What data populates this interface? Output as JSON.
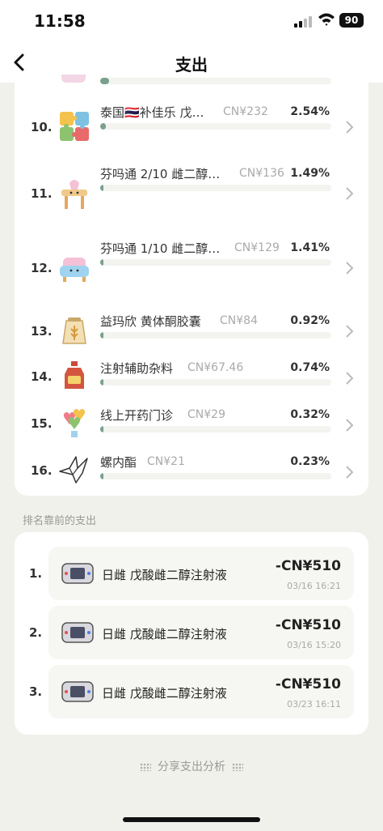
{
  "status": {
    "time": "11:58",
    "battery": "90"
  },
  "nav": {
    "title": "支出"
  },
  "categories": [
    {
      "rank": "10.",
      "name": "泰国🇹🇭补佳乐 戊…",
      "amount": "CN¥232",
      "pct": "2.54%",
      "fill": 0.024,
      "icon": "puzzle-icon"
    },
    {
      "rank": "11.",
      "name": "芬吗通 2/10 雌二醇…",
      "amount": "CN¥136",
      "pct": "1.49%",
      "fill": 0.014,
      "icon": "cute-table-icon"
    },
    {
      "rank": "12.",
      "name": "芬吗通 1/10 雌二醇…",
      "amount": "CN¥129",
      "pct": "1.41%",
      "fill": 0.013,
      "icon": "cute-sofa-icon"
    },
    {
      "rank": "13.",
      "name": "益玛欣 黄体酮胶囊",
      "amount": "CN¥84",
      "pct": "0.92%",
      "fill": 0.009,
      "icon": "wheat-sack-icon"
    },
    {
      "rank": "14.",
      "name": "注射辅助杂料",
      "amount": "CN¥67.46",
      "pct": "0.74%",
      "fill": 0.007,
      "icon": "honey-bottle-icon"
    },
    {
      "rank": "15.",
      "name": "线上开药门诊",
      "amount": "CN¥29",
      "pct": "0.32%",
      "fill": 0.003,
      "icon": "heart-balloons-icon"
    },
    {
      "rank": "16.",
      "name": "螺内酯",
      "amount": "CN¥21",
      "pct": "0.23%",
      "fill": 0.002,
      "icon": "origami-bird-icon"
    }
  ],
  "top_section": {
    "title": "排名靠前的支出"
  },
  "top_expenses": [
    {
      "rank": "1.",
      "name": "日雌 戊酸雌二醇注射液",
      "amount": "-CN¥510",
      "time": "03/16 16:21",
      "icon": "game-console-icon"
    },
    {
      "rank": "2.",
      "name": "日雌 戊酸雌二醇注射液",
      "amount": "-CN¥510",
      "time": "03/16 15:20",
      "icon": "game-console-icon"
    },
    {
      "rank": "3.",
      "name": "日雌 戊酸雌二醇注射液",
      "amount": "-CN¥510",
      "time": "03/23 16:11",
      "icon": "game-console-icon"
    }
  ],
  "share": {
    "label": "分享支出分析"
  },
  "colors": {
    "progress_fill": "#7aa08d",
    "background": "#f1f1ec",
    "card": "#ffffff"
  }
}
